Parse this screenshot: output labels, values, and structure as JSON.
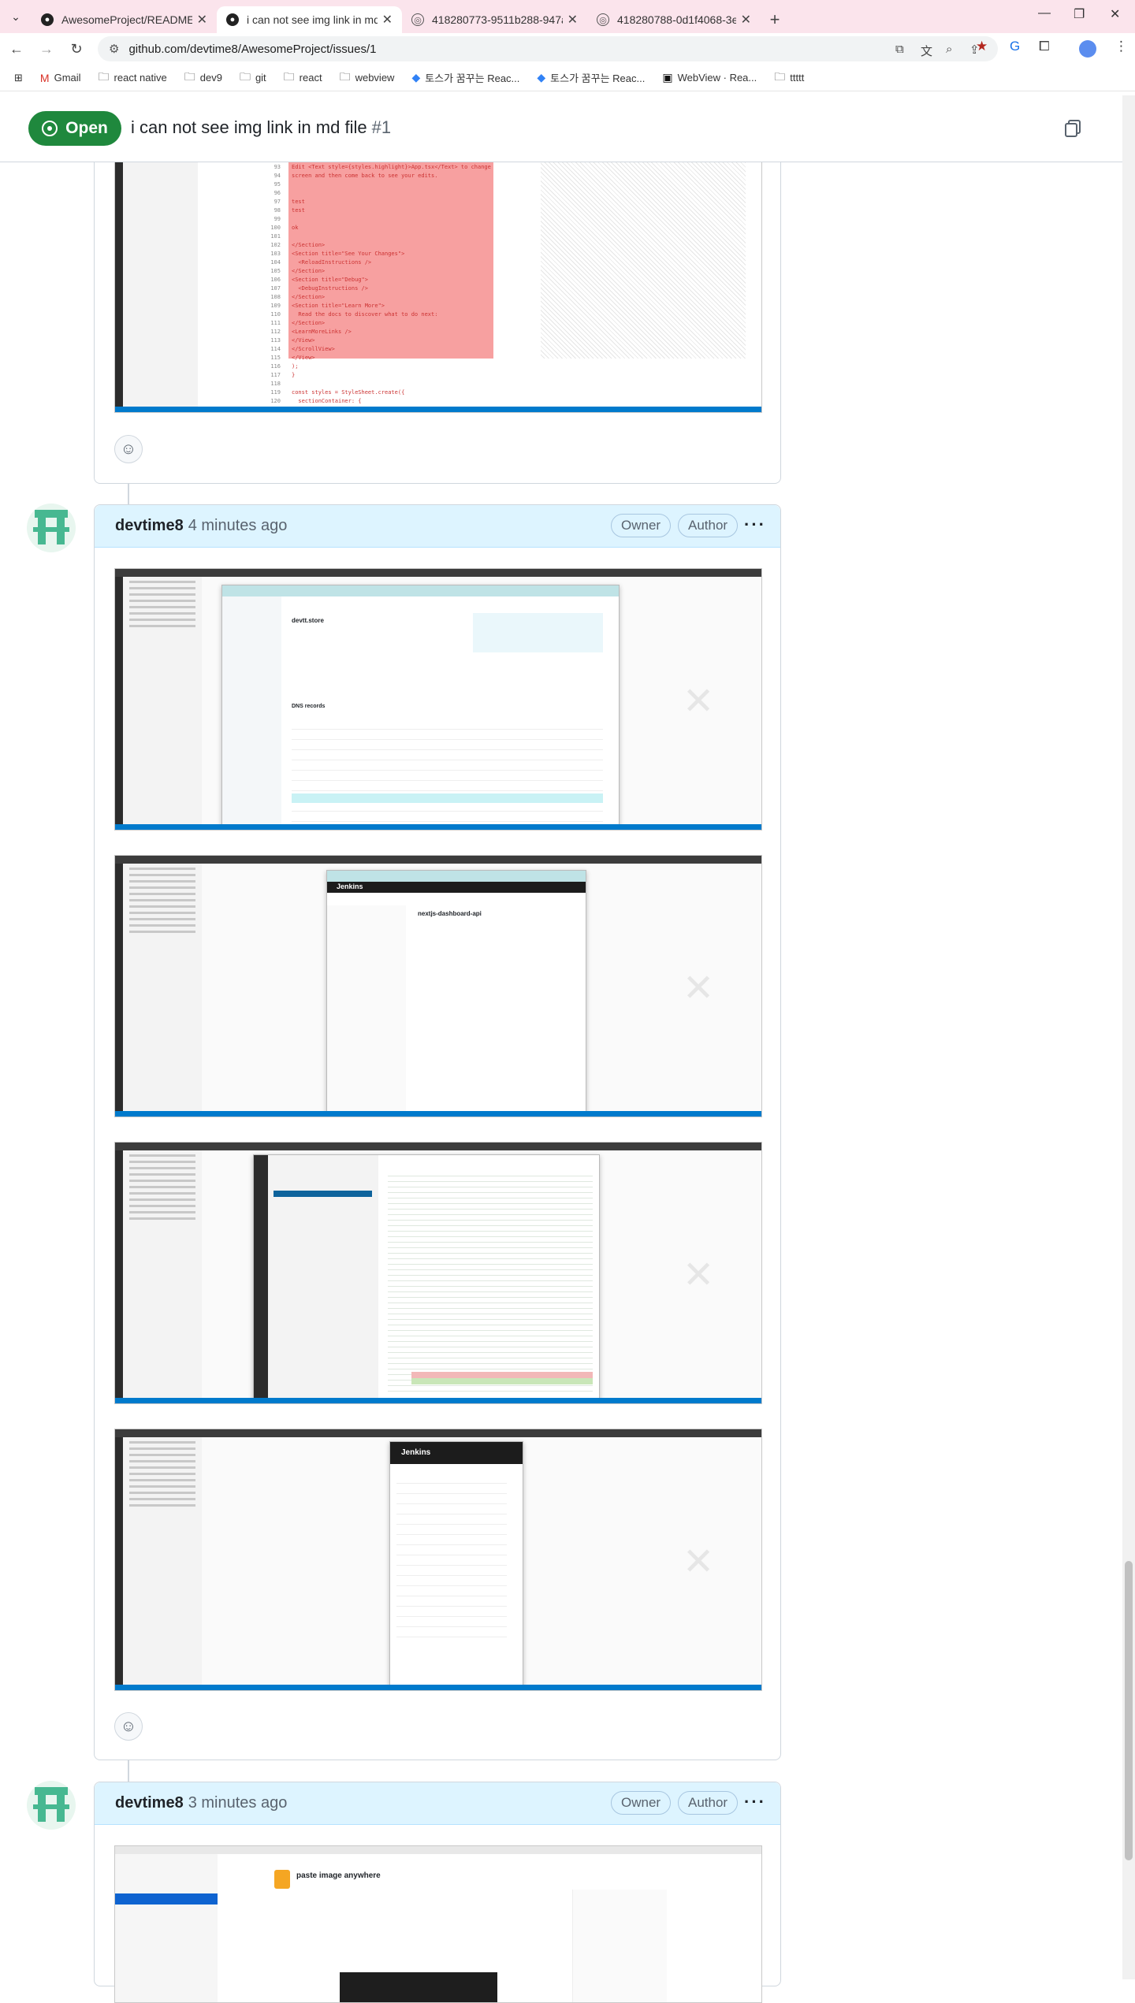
{
  "browser": {
    "tabs": [
      {
        "title": "AwesomeProject/README_local...",
        "active": false
      },
      {
        "title": "i can not see img link in md fi",
        "active": true
      },
      {
        "title": "418280773-9511b288-947a-47...",
        "active": false
      },
      {
        "title": "418280788-0d1f4068-3e6e-4f...",
        "active": false
      }
    ],
    "url": "github.com/devtime8/AwesomeProject/issues/1",
    "bookmarks": [
      "Gmail",
      "react native",
      "dev9",
      "git",
      "react",
      "webview",
      "토스가 꿈꾸는 Reac...",
      "토스가 꿈꾸는 Reac...",
      "WebView · Rea...",
      "ttttt"
    ]
  },
  "issue": {
    "state": "Open",
    "title": "i can not see img link in md file",
    "number": "#1"
  },
  "comments": [
    {
      "author": "devtime8",
      "time": "4 minutes ago",
      "labels": [
        "Owner",
        "Author"
      ],
      "images": 4
    },
    {
      "author": "devtime8",
      "time": "3 minutes ago",
      "labels": [
        "Owner",
        "Author"
      ],
      "images": 1
    }
  ],
  "first_shot": {
    "code_lines": [
      "Edit <Text style={styles.highlight}>App.tsx</Text> to change",
      "screen and then come back to see your edits.",
      "",
      "",
      "test",
      "test",
      "",
      "ok",
      "",
      "</Section>",
      "<Section title=\"See Your Changes\">",
      "  <ReloadInstructions />",
      "</Section>",
      "<Section title=\"Debug\">",
      "  <DebugInstructions />",
      "</Section>",
      "<Section title=\"Learn More\">",
      "  Read the docs to discover what to do next:",
      "</Section>",
      "<LearnMoreLinks />",
      "</View>",
      "</ScrollView>",
      "</View>",
      ");",
      "}",
      "",
      "const styles = StyleSheet.create({",
      "  sectionContainer: {"
    ],
    "line_numbers": [
      "93",
      "94",
      "95",
      "96",
      "97",
      "98",
      "99",
      "100",
      "101",
      "102",
      "103",
      "104",
      "105",
      "106",
      "107",
      "108",
      "109",
      "110",
      "111",
      "112",
      "113",
      "114",
      "115",
      "116",
      "117",
      "118",
      "119",
      "120"
    ]
  },
  "embedded_text": {
    "dns_title": "devtt.store",
    "dns_records": "DNS records",
    "jenkins": "Jenkins",
    "job": "nextjs-dashboard-api",
    "paste_title": "paste image anywhere"
  }
}
